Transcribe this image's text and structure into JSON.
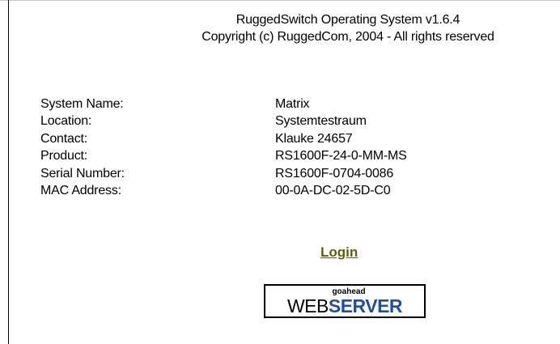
{
  "header": {
    "title": "RuggedSwitch Operating System v1.6.4",
    "copyright": "Copyright (c) RuggedCom, 2004 - All rights reserved"
  },
  "info": [
    {
      "label": "System Name:",
      "value": "Matrix"
    },
    {
      "label": "Location:",
      "value": "Systemtestraum"
    },
    {
      "label": "Contact:",
      "value": "Klauke 24657"
    },
    {
      "label": "Product:",
      "value": "RS1600F-24-0-MM-MS"
    },
    {
      "label": "Serial Number:",
      "value": "RS1600F-0704-0086"
    },
    {
      "label": "MAC Address:",
      "value": "00-0A-DC-02-5D-C0"
    }
  ],
  "login": {
    "label": "Login",
    "color": "#5f5f12"
  },
  "logo": {
    "small_text": "goahead",
    "web_text": "WEB",
    "server_text": "SERVER",
    "server_color": "#1f4fa0"
  }
}
